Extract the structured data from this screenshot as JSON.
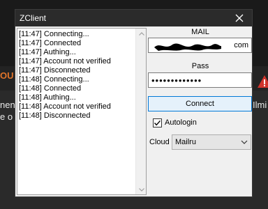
{
  "window": {
    "title": "ZClient"
  },
  "background": {
    "fragments": [
      "OU",
      "nen",
      "e o",
      "Ilmi"
    ]
  },
  "log": {
    "lines": [
      "[11:47] Connecting...",
      "[11:47] Connected",
      "[11:47] Authing...",
      "[11:47] Account not verified",
      "[11:47] Disconnected",
      "[11:48] Connecting...",
      "[11:48] Connected",
      "[11:48] Authing...",
      "[11:48] Account not verified",
      "[11:48] Disconnected"
    ]
  },
  "form": {
    "mail_label": "MAIL",
    "mail_value": "com",
    "pass_label": "Pass",
    "pass_value": "•••••••••••••",
    "connect_label": "Connect",
    "autologin_label": "Autologin",
    "autologin_checked": true,
    "cloud_label": "Cloud",
    "cloud_value": "Mailru"
  },
  "icons": [
    "close-icon",
    "warning-icon",
    "chevron-down-icon",
    "checkmark-icon",
    "scroll-up-arrow-icon",
    "scroll-down-arrow-icon"
  ],
  "colors": {
    "titlebar": "#2b2b2b",
    "accent": "#0078d7",
    "warning": "#d0342c"
  }
}
